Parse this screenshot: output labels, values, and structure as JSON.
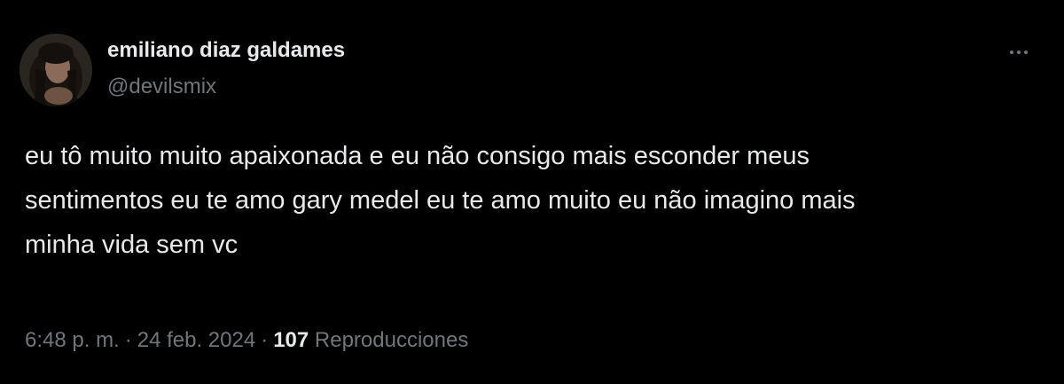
{
  "tweet": {
    "display_name": "emiliano diaz galdames",
    "handle": "@devilsmix",
    "text_lines": [
      "eu tô muito muito apaixonada e eu não consigo mais esconder meus",
      "sentimentos eu te amo gary medel eu te amo muito eu não imagino mais",
      "minha vida sem vc"
    ],
    "time": "6:48 p. m.",
    "separator": "·",
    "date": "24 feb. 2024",
    "views_count": "107",
    "views_label": "Reproducciones",
    "more_icon": "more-horizontal-icon"
  },
  "colors": {
    "background": "#000000",
    "primary_text": "#e7e9ea",
    "secondary_text": "#71767b"
  }
}
